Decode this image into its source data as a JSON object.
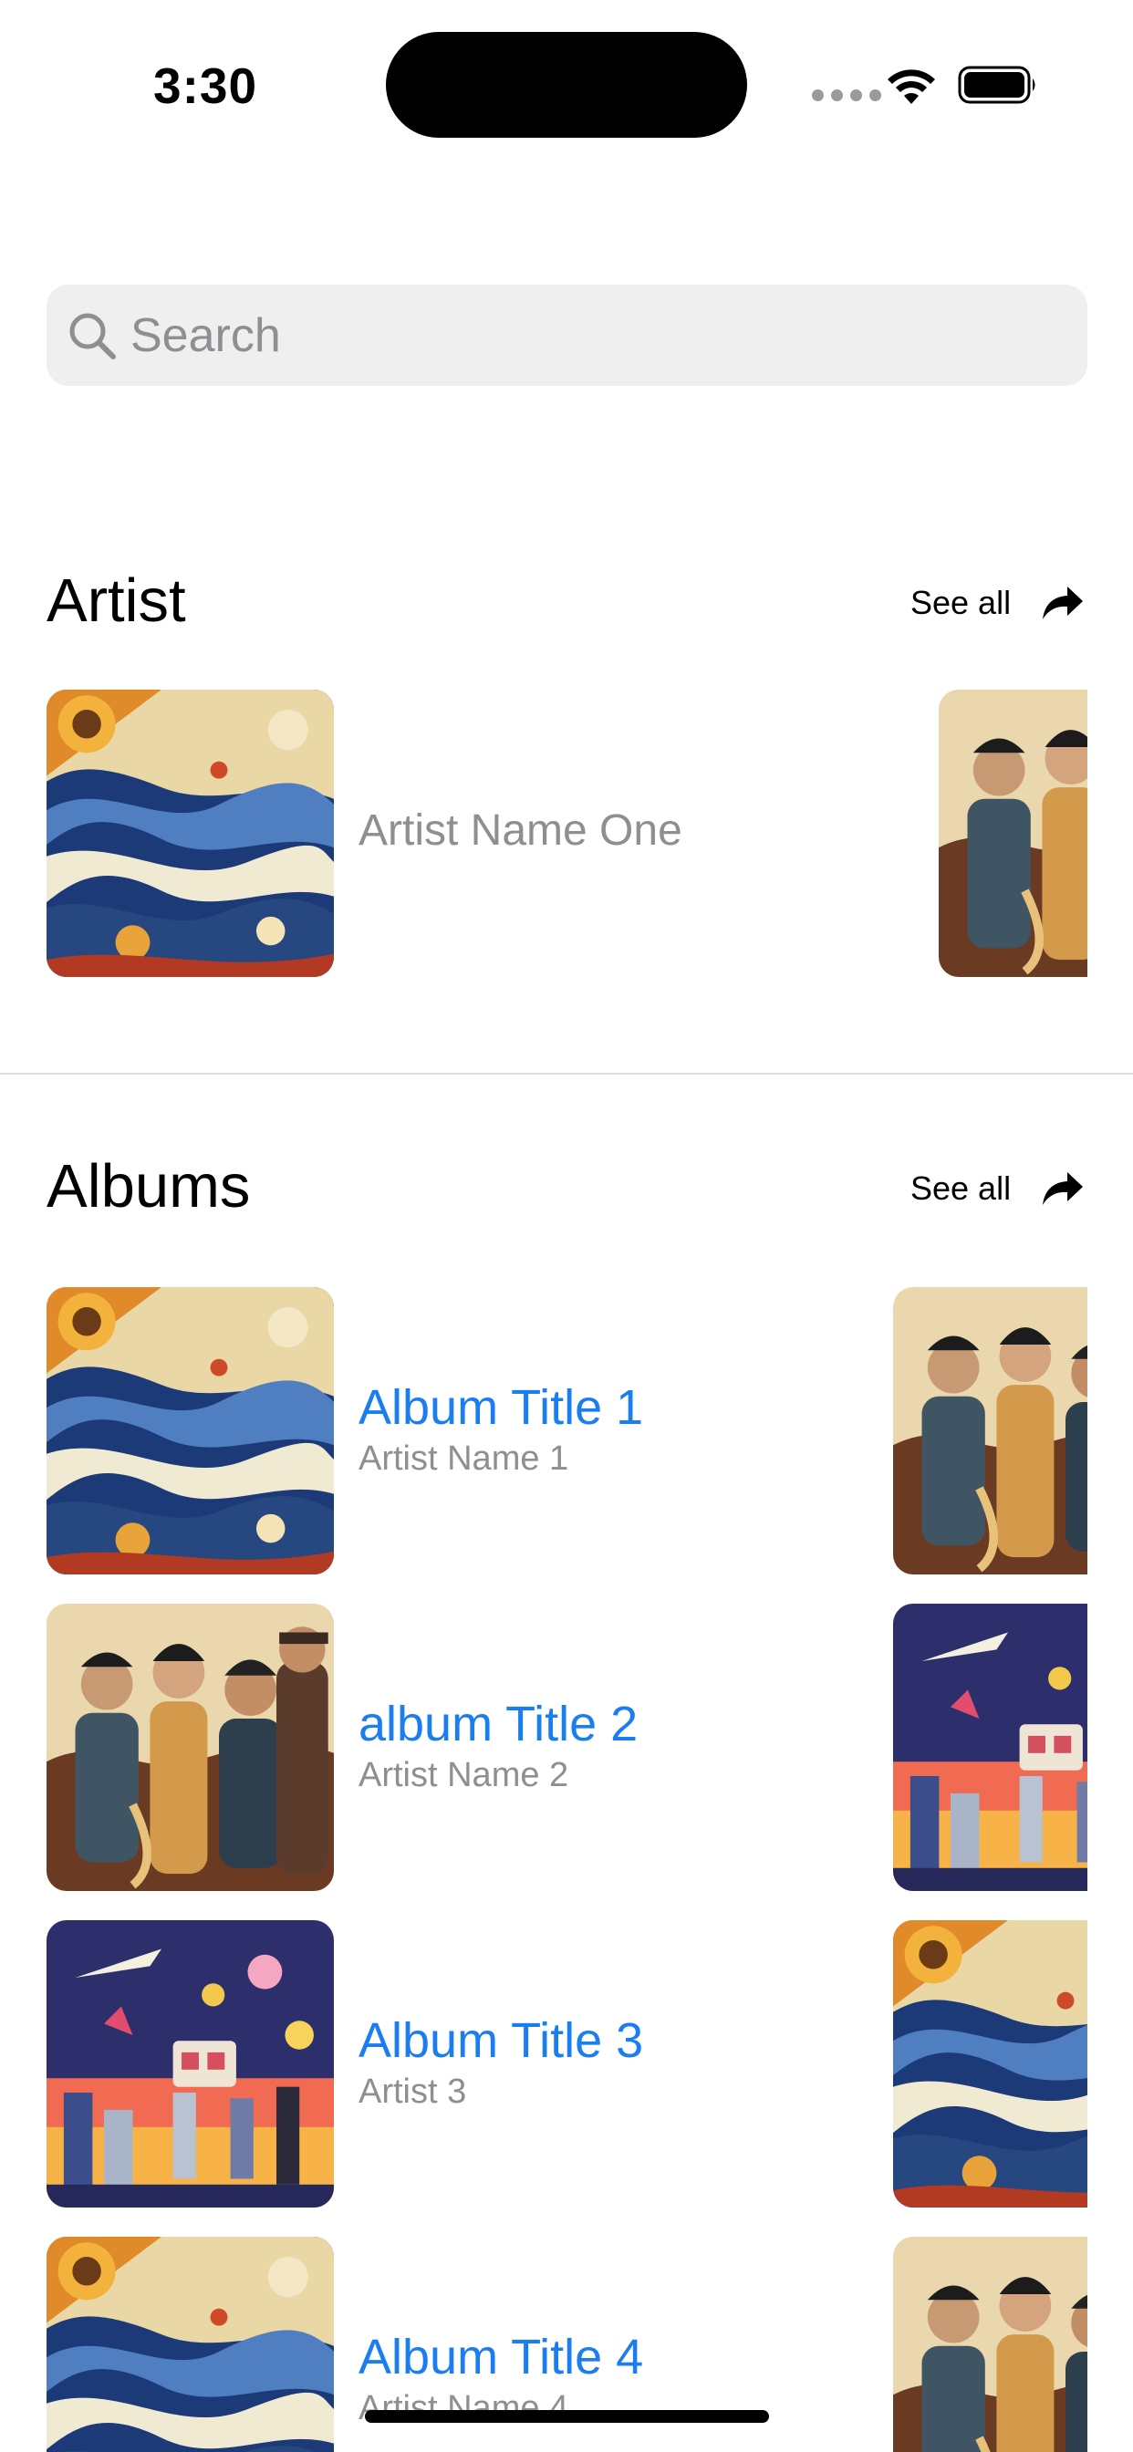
{
  "status_bar": {
    "time": "3:30",
    "icons": [
      "cellular-signal-icon",
      "wifi-icon",
      "battery-icon"
    ]
  },
  "search": {
    "placeholder": "Search",
    "value": ""
  },
  "artists_section": {
    "title": "Artist",
    "see_all_label": "See all",
    "items": [
      {
        "name": "Artist Name One",
        "artwork": "stained-glass-waves"
      },
      {
        "name": "",
        "artwork": "jazz-trio"
      }
    ]
  },
  "albums_section": {
    "title": "Albums",
    "see_all_label": "See all",
    "rows": [
      {
        "title": "Album Title 1",
        "artist": "Artist Name 1",
        "artwork": "stained-glass-waves",
        "next_artwork": "jazz-trio"
      },
      {
        "title": "album Title 2",
        "artist": "Artist Name 2",
        "artwork": "jazz-trio",
        "next_artwork": "retro-robots"
      },
      {
        "title": "Album Title 3",
        "artist": "Artist 3",
        "artwork": "retro-robots",
        "next_artwork": "stained-glass-waves"
      },
      {
        "title": "Album Title 4",
        "artist": "Artist Name 4",
        "artwork": "stained-glass-waves",
        "next_artwork": "jazz-trio"
      }
    ]
  },
  "colors": {
    "accent": "#1a7df0",
    "secondary_text": "#8e8e93",
    "search_background": "#efefef",
    "divider": "#dcdcdc"
  }
}
